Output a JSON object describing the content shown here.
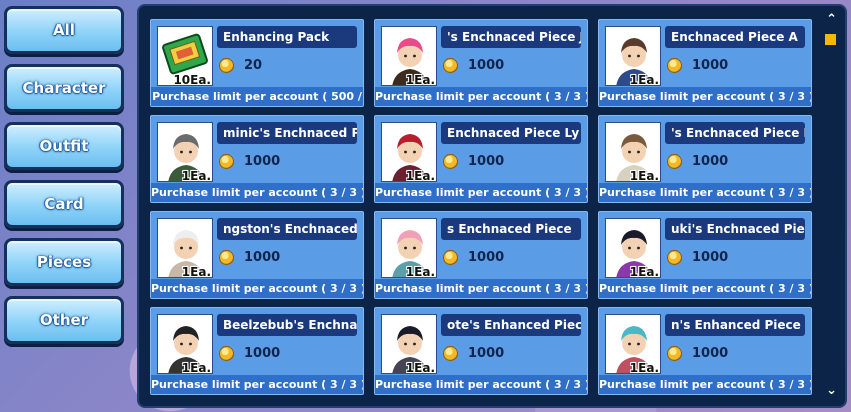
{
  "sidebar": {
    "categories": [
      {
        "label": "All"
      },
      {
        "label": "Character"
      },
      {
        "label": "Outfit"
      },
      {
        "label": "Card"
      },
      {
        "label": "Pieces"
      },
      {
        "label": "Other"
      }
    ]
  },
  "items": [
    {
      "name": "Enhancing Pack",
      "qty": "10Ea.",
      "price": "20",
      "limit": "Purchase limit per account ( 500 /",
      "icon": "enhancing-pack-icon"
    },
    {
      "name": "'s Enchnaced Piece   J",
      "qty": "1Ea.",
      "price": "1000",
      "limit": "Purchase limit per account ( 3 / 3 )",
      "icon": "character-portrait"
    },
    {
      "name": "Enchnaced Piece   A",
      "qty": "1Ea.",
      "price": "1000",
      "limit": "Purchase limit per account ( 3 / 3 )",
      "icon": "character-portrait"
    },
    {
      "name": "minic's Enchnaced Pi",
      "qty": "1Ea.",
      "price": "1000",
      "limit": "Purchase limit per account ( 3 / 3 )",
      "icon": "character-portrait"
    },
    {
      "name": "Enchnaced Piece   Ly",
      "qty": "1Ea.",
      "price": "1000",
      "limit": "Purchase limit per account ( 3 / 3 )",
      "icon": "character-portrait"
    },
    {
      "name": "'s Enchnaced Piece   E",
      "qty": "1Ea.",
      "price": "1000",
      "limit": "Purchase limit per account ( 3 / 3 )",
      "icon": "character-portrait"
    },
    {
      "name": "ngston's Enchnaced I",
      "qty": "1Ea.",
      "price": "1000",
      "limit": "Purchase limit per account ( 3 / 3 )",
      "icon": "character-portrait"
    },
    {
      "name": "s Enchnaced Piece",
      "qty": "1Ea.",
      "price": "1000",
      "limit": "Purchase limit per account ( 3 / 3 )",
      "icon": "character-portrait"
    },
    {
      "name": "uki's Enchnaced Piec",
      "qty": "1Ea.",
      "price": "1000",
      "limit": "Purchase limit per account ( 3 / 3 )",
      "icon": "character-portrait"
    },
    {
      "name": "Beelzebub's Enchnac",
      "qty": "1Ea.",
      "price": "1000",
      "limit": "Purchase limit per account ( 3 / 3 )",
      "icon": "character-portrait"
    },
    {
      "name": "ote's Enhanced Piece",
      "qty": "1Ea.",
      "price": "1000",
      "limit": "Purchase limit per account ( 3 / 3 )",
      "icon": "character-portrait"
    },
    {
      "name": "n's Enhanced Piece",
      "qty": "1Ea.",
      "price": "1000",
      "limit": "Purchase limit per account ( 3 / 3 )",
      "icon": "character-portrait"
    }
  ],
  "scroll": {
    "up_icon": "chevron-up-icon",
    "down_icon": "chevron-down-icon"
  },
  "colors": {
    "card_bg": "#5b9ce6",
    "panel_bg": "#0c2448",
    "name_bar": "#1a3a7d",
    "scroll_thumb": "#f3b800"
  }
}
